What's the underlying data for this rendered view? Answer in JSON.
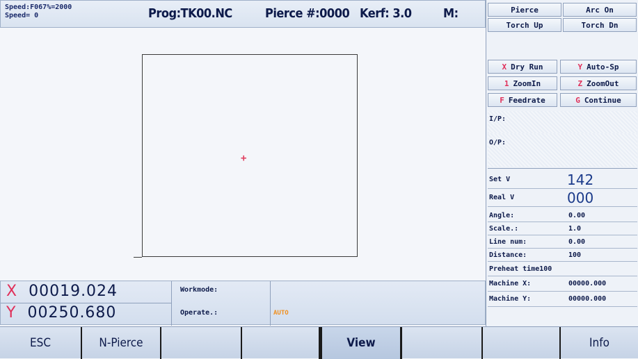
{
  "topbar": {
    "speed_line1": "Speed:F067%=2000",
    "speed_line2": "Speed=  0",
    "program": "Prog:TK00.NC",
    "pierce_count": "Pierce #:0000",
    "kerf": "Kerf: 3.0",
    "m_code": "M:"
  },
  "right_buttons": {
    "pierce": "Pierce",
    "arc_on": "Arc On",
    "torch_up": "Torch Up",
    "torch_dn": "Torch Dn",
    "dry_run_key": "X",
    "dry_run": "Dry Run",
    "auto_sp_key": "Y",
    "auto_sp": "Auto-Sp",
    "zoom_in_key": "1",
    "zoom_in": "ZoomIn",
    "zoom_out_key": "Z",
    "zoom_out": "ZoomOut",
    "feedrate_key": "F",
    "feedrate": "Feedrate",
    "continue_key": "G",
    "continue": "Continue"
  },
  "io": {
    "input_label": "I/P:",
    "output_label": "O/P:"
  },
  "params": {
    "set_v_label": "Set  V",
    "set_v_value": "142",
    "real_v_label": "Real V",
    "real_v_value": "000",
    "angle_label": "Angle:",
    "angle_value": "0.00",
    "scale_label": "Scale.:",
    "scale_value": "1.0",
    "line_num_label": "Line num:",
    "line_num_value": "0.00",
    "distance_label": "Distance:",
    "distance_value": "100",
    "preheat_label": "Preheat time",
    "preheat_value": "100",
    "machine_x_label": "Machine X:",
    "machine_x_value": "00000.000",
    "machine_y_label": "Machine Y:",
    "machine_y_value": "00000.000"
  },
  "position": {
    "x_axis": "X",
    "x_value": "00019.024",
    "y_axis": "Y",
    "y_value": "00250.680"
  },
  "status": {
    "workmode_label": "Workmode:",
    "operate_label": "Operate.:",
    "operate_value": "AUTO"
  },
  "function_keys": [
    "ESC",
    "N-Pierce",
    "",
    "",
    "View",
    "",
    "",
    "Info"
  ]
}
